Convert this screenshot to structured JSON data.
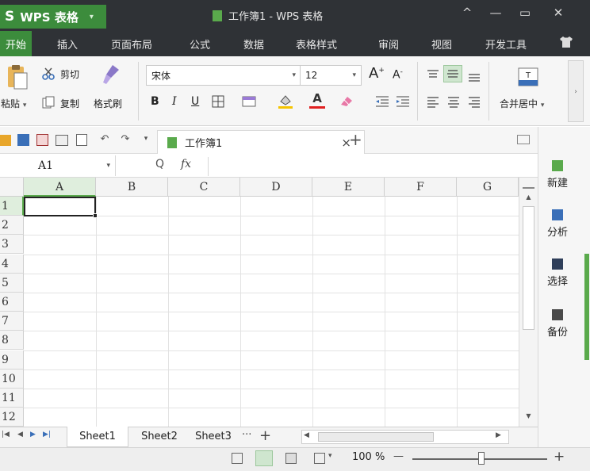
{
  "titlebar": {
    "app_name": "WPS 表格",
    "app_logo": "S",
    "app_caret": "▾",
    "doc_title": "工作簿1 - WPS 表格",
    "btn_up": "^",
    "btn_min": "—",
    "btn_max": "▭",
    "btn_close": "✕"
  },
  "menu": {
    "items": [
      "开始",
      "插入",
      "页面布局",
      "公式",
      "数据",
      "表格样式",
      "审阅",
      "视图",
      "开发工具"
    ],
    "shirt_icon": "👕"
  },
  "ribbon": {
    "paste": "粘贴",
    "cut": "剪切",
    "copy": "复制",
    "format_painter": "格式刷",
    "font_name": "宋体",
    "font_size": "12",
    "grow_font": "A",
    "shrink_font": "A",
    "bold": "B",
    "italic": "I",
    "underline": "U",
    "merge_center": "合并居中",
    "dropdown": "▾"
  },
  "quickbar": {
    "doc_tab": "工作簿1",
    "close_tab": "×",
    "new_tab": "+"
  },
  "formula_bar": {
    "cell_ref": "A1",
    "zoom_label": "Q",
    "fx": "fx",
    "value": ""
  },
  "grid": {
    "columns": [
      "A",
      "B",
      "C",
      "D",
      "E",
      "F",
      "G"
    ],
    "rows": [
      "1",
      "2",
      "3",
      "4",
      "5",
      "6",
      "7",
      "8",
      "9",
      "10",
      "11",
      "12"
    ],
    "active_cell": "A1"
  },
  "sheets": {
    "tabs": [
      "Sheet1",
      "Sheet2",
      "Sheet3"
    ],
    "active": "Sheet1",
    "more": "···",
    "add": "+"
  },
  "status": {
    "zoom": "100 %",
    "zoom_minus": "—",
    "zoom_plus": "+",
    "zoom_fraction": 0.5
  },
  "sidepanel": {
    "items": [
      "新建",
      "分析",
      "选择",
      "备份"
    ]
  },
  "colors": {
    "accent": "#3c8c3c",
    "titlebar": "#2f3236",
    "ribbon": "#f6f6f6",
    "font_red": "#e02020",
    "fill_yellow": "#f5c400"
  }
}
